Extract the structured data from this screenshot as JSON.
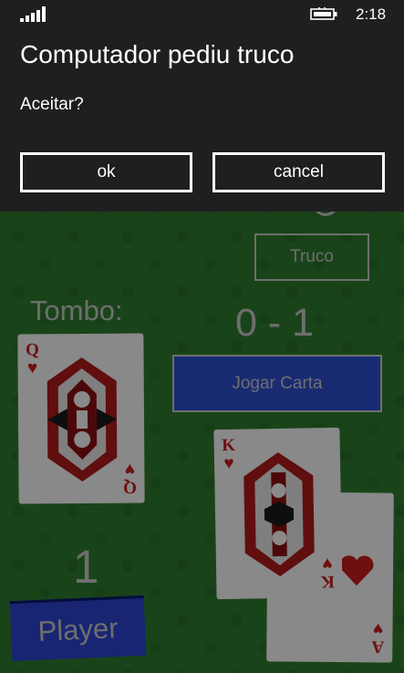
{
  "status_bar": {
    "time": "2:18",
    "signal_icon": "signal-bars-icon",
    "battery_icon": "battery-charging-icon"
  },
  "dialog": {
    "title": "Computador pediu truco",
    "message": "Aceitar?",
    "ok_label": "ok",
    "cancel_label": "cancel"
  },
  "game": {
    "truco_label": "Truco",
    "tombo_label": "Tombo:",
    "score": "0 - 1",
    "jogar_carta_label": "Jogar Carta",
    "player_count": "1",
    "player_label": "Player",
    "cards": {
      "tombo": {
        "rank": "Q",
        "suit": "♥"
      },
      "played_top": {
        "rank": "K",
        "suit": "♥"
      },
      "played_bottom": {
        "rank": "A",
        "suit": "♥"
      }
    }
  },
  "colors": {
    "table_green": "#2f7d2f",
    "dialog_bg": "#1f1f1f",
    "button_blue": "#2c4fd0",
    "card_red": "#c81e1e"
  }
}
